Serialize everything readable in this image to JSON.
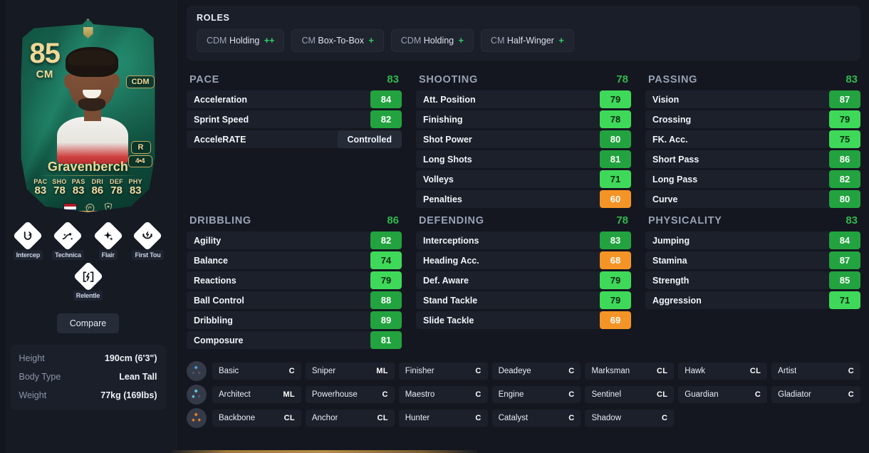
{
  "card": {
    "rating": "85",
    "position": "CM",
    "alt_position": "CDM",
    "name": "Gravenberch",
    "foot": "R",
    "skills_weakfoot": "4•4",
    "stats": [
      {
        "label": "PAC",
        "value": "83"
      },
      {
        "label": "SHO",
        "value": "78"
      },
      {
        "label": "PAS",
        "value": "83"
      },
      {
        "label": "DRI",
        "value": "86"
      },
      {
        "label": "DEF",
        "value": "78"
      },
      {
        "label": "PHY",
        "value": "83"
      }
    ],
    "nation_icon": "netherlands-flag-icon",
    "league_icon": "premier-league-icon",
    "club_icon": "liverpool-crest-icon"
  },
  "playstyles": [
    {
      "label": "Intercep",
      "icon": "interceptions-playstyle-icon"
    },
    {
      "label": "Technica",
      "icon": "technical-playstyle-icon"
    },
    {
      "label": "Flair",
      "icon": "flair-playstyle-icon"
    },
    {
      "label": "First Tou",
      "icon": "first-touch-playstyle-icon"
    },
    {
      "label": "Relentle",
      "icon": "relentless-playstyle-icon"
    }
  ],
  "compare_label": "Compare",
  "info": [
    {
      "key": "Height",
      "value": "190cm (6'3\")"
    },
    {
      "key": "Body Type",
      "value": "Lean Tall"
    },
    {
      "key": "Weight",
      "value": "77kg (169lbs)"
    }
  ],
  "roles": {
    "title": "ROLES",
    "items": [
      {
        "position": "CDM",
        "role": "Holding",
        "plus": "++"
      },
      {
        "position": "CM",
        "role": "Box-To-Box",
        "plus": "+"
      },
      {
        "position": "CDM",
        "role": "Holding",
        "plus": "+"
      },
      {
        "position": "CM",
        "role": "Half-Winger",
        "plus": "+"
      }
    ]
  },
  "stat_groups": [
    {
      "name": "PACE",
      "value": "83",
      "rows": [
        {
          "label": "Acceleration",
          "value": "84",
          "tier": "v-hi"
        },
        {
          "label": "Sprint Speed",
          "value": "82",
          "tier": "v-hi"
        },
        {
          "label": "AcceleRATE",
          "value": "Controlled",
          "tier": "accelerate"
        }
      ]
    },
    {
      "name": "SHOOTING",
      "value": "78",
      "rows": [
        {
          "label": "Att. Position",
          "value": "79",
          "tier": "v-mid"
        },
        {
          "label": "Finishing",
          "value": "78",
          "tier": "v-mid"
        },
        {
          "label": "Shot Power",
          "value": "80",
          "tier": "v-hi"
        },
        {
          "label": "Long Shots",
          "value": "81",
          "tier": "v-hi"
        },
        {
          "label": "Volleys",
          "value": "71",
          "tier": "v-mid"
        },
        {
          "label": "Penalties",
          "value": "60",
          "tier": "v-low"
        }
      ]
    },
    {
      "name": "PASSING",
      "value": "83",
      "rows": [
        {
          "label": "Vision",
          "value": "87",
          "tier": "v-hi"
        },
        {
          "label": "Crossing",
          "value": "79",
          "tier": "v-mid"
        },
        {
          "label": "FK. Acc.",
          "value": "75",
          "tier": "v-mid"
        },
        {
          "label": "Short Pass",
          "value": "86",
          "tier": "v-hi"
        },
        {
          "label": "Long Pass",
          "value": "82",
          "tier": "v-hi"
        },
        {
          "label": "Curve",
          "value": "80",
          "tier": "v-hi"
        }
      ]
    },
    {
      "name": "DRIBBLING",
      "value": "86",
      "rows": [
        {
          "label": "Agility",
          "value": "82",
          "tier": "v-hi"
        },
        {
          "label": "Balance",
          "value": "74",
          "tier": "v-mid"
        },
        {
          "label": "Reactions",
          "value": "79",
          "tier": "v-mid"
        },
        {
          "label": "Ball Control",
          "value": "88",
          "tier": "v-hi"
        },
        {
          "label": "Dribbling",
          "value": "89",
          "tier": "v-hi"
        },
        {
          "label": "Composure",
          "value": "81",
          "tier": "v-hi"
        }
      ]
    },
    {
      "name": "DEFENDING",
      "value": "78",
      "rows": [
        {
          "label": "Interceptions",
          "value": "83",
          "tier": "v-hi"
        },
        {
          "label": "Heading Acc.",
          "value": "68",
          "tier": "v-low"
        },
        {
          "label": "Def. Aware",
          "value": "79",
          "tier": "v-mid"
        },
        {
          "label": "Stand Tackle",
          "value": "79",
          "tier": "v-mid"
        },
        {
          "label": "Slide Tackle",
          "value": "69",
          "tier": "v-low"
        }
      ]
    },
    {
      "name": "PHYSICALITY",
      "value": "83",
      "rows": [
        {
          "label": "Jumping",
          "value": "84",
          "tier": "v-hi"
        },
        {
          "label": "Stamina",
          "value": "87",
          "tier": "v-hi"
        },
        {
          "label": "Strength",
          "value": "85",
          "tier": "v-hi"
        },
        {
          "label": "Aggression",
          "value": "71",
          "tier": "v-mid"
        }
      ]
    }
  ],
  "chem_styles": [
    {
      "tier_icon": "one-diamond-chem-icon",
      "tier_color": "#4aa8d8",
      "cells": [
        {
          "name": "Basic",
          "tag": "C"
        },
        {
          "name": "Sniper",
          "tag": "ML"
        },
        {
          "name": "Finisher",
          "tag": "C"
        },
        {
          "name": "Deadeye",
          "tag": "C"
        },
        {
          "name": "Marksman",
          "tag": "CL"
        },
        {
          "name": "Hawk",
          "tag": "CL"
        },
        {
          "name": "Artist",
          "tag": "C"
        }
      ]
    },
    {
      "tier_icon": "two-diamond-chem-icon",
      "tier_color": "#63c7e8",
      "cells": [
        {
          "name": "Architect",
          "tag": "ML"
        },
        {
          "name": "Powerhouse",
          "tag": "C"
        },
        {
          "name": "Maestro",
          "tag": "C"
        },
        {
          "name": "Engine",
          "tag": "C"
        },
        {
          "name": "Sentinel",
          "tag": "CL"
        },
        {
          "name": "Guardian",
          "tag": "C"
        },
        {
          "name": "Gladiator",
          "tag": "C"
        }
      ]
    },
    {
      "tier_icon": "three-diamond-chem-icon",
      "tier_color": "#e8832a",
      "cells": [
        {
          "name": "Backbone",
          "tag": "CL"
        },
        {
          "name": "Anchor",
          "tag": "CL"
        },
        {
          "name": "Hunter",
          "tag": "C"
        },
        {
          "name": "Catalyst",
          "tag": "C"
        },
        {
          "name": "Shadow",
          "tag": "C"
        }
      ]
    }
  ],
  "colors": {
    "accent_green": "#2fb84f",
    "high": "#22a33f",
    "mid": "#3fd95a",
    "low": "#f59426",
    "card_gold": "#f0d898",
    "background": "#14171f"
  }
}
